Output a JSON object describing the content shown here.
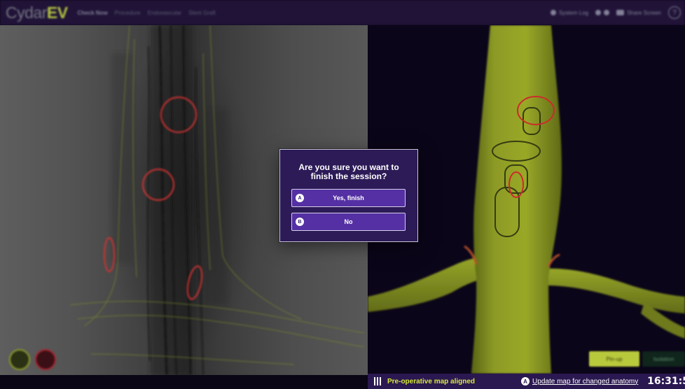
{
  "topbar": {
    "brand_main": "Cydar",
    "brand_suffix": "EV",
    "crumbs": [
      "Check Now",
      "Procedure",
      "Endovascular",
      "Stent Graft"
    ],
    "right_items": [
      "System Log",
      "Share Screen"
    ],
    "help_icon": "?"
  },
  "dialog": {
    "title": "Are you sure you want to finish the session?",
    "yes": {
      "key": "A",
      "label": "Yes, finish"
    },
    "no": {
      "key": "B",
      "label": "No"
    }
  },
  "model_panel": {
    "view_buttons": [
      "Pin-up",
      "Isolation"
    ]
  },
  "statusbar": {
    "aligned_text": "Pre-operative map aligned",
    "update_key": "A",
    "update_text": "Update map for changed anatomy",
    "clock": "16:31:5"
  },
  "colors": {
    "accent_yellow": "#d7ea3c",
    "dialog_bg": "#2c1b57",
    "button_bg": "#5530a4",
    "status_bg": "#2a1850",
    "marker_red": "#d23232"
  }
}
